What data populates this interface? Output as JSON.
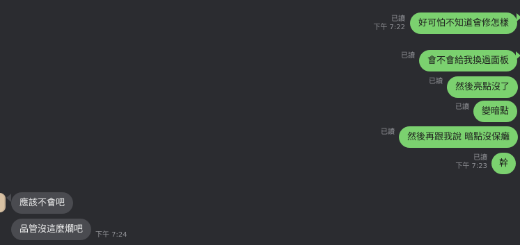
{
  "chat": {
    "outgoing": [
      {
        "text": "好可怕不知道會修怎樣",
        "read": "已讀",
        "time": "下午 7:22"
      },
      {
        "text": "會不會給我換過面板",
        "read": "已讀",
        "time": ""
      },
      {
        "text": "然後亮點沒了",
        "read": "已讀",
        "time": ""
      },
      {
        "text": "變暗點",
        "read": "已讀",
        "time": ""
      },
      {
        "text": "然後再跟我說 暗點沒保癱",
        "read": "已讀",
        "time": ""
      },
      {
        "text": "幹",
        "read": "已讀",
        "time": "下午 7:23"
      }
    ],
    "incoming": [
      {
        "text": "應該不會吧"
      },
      {
        "text": "品管沒這麼爛吧",
        "time": "下午 7:24"
      }
    ]
  },
  "colors": {
    "background": "#2b2c30",
    "outgoing_bubble": "#7bd16f",
    "incoming_bubble": "#4a4b50",
    "meta_text": "#8f9095"
  }
}
